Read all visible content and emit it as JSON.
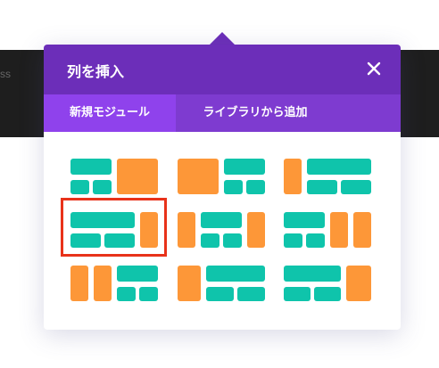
{
  "background": {
    "partial_text": "ss"
  },
  "dialog": {
    "title": "列を挿入",
    "close_icon": "close-icon",
    "tabs": [
      {
        "label": "新規モジュール",
        "active": true
      },
      {
        "label": "ライブラリから追加",
        "active": false
      }
    ]
  },
  "colors": {
    "header": "#6c2eb9",
    "tab_bar": "#7e3bd0",
    "active_tab": "#8f42ec",
    "teal": "#0fc4ab",
    "orange": "#fd9738",
    "highlight": "#e8321a"
  },
  "layouts": [
    {
      "name": "layout-1-1-ratio-3-2",
      "selected": false
    },
    {
      "name": "layout-2-3-with-split",
      "selected": false
    },
    {
      "name": "layout-1-4-3-4",
      "selected": false
    },
    {
      "name": "layout-3-4-1-4",
      "selected": true
    },
    {
      "name": "layout-1-4-1-2-1-4",
      "selected": false
    },
    {
      "name": "layout-1-2-1-4-1-4",
      "selected": false
    },
    {
      "name": "layout-1-4-1-4-1-2",
      "selected": false
    },
    {
      "name": "layout-1-4-3-4-split",
      "selected": false
    },
    {
      "name": "layout-3-4-1-4-split",
      "selected": false
    }
  ]
}
